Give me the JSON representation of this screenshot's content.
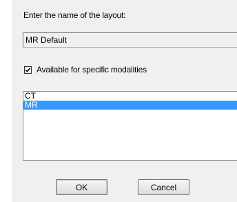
{
  "dialog": {
    "prompt": "Enter the name of the layout:",
    "name_value": "MR Default",
    "checkbox_label": "Available for specific modalities",
    "checkbox_checked": true,
    "modalities": [
      {
        "label": "CT",
        "selected": false
      },
      {
        "label": "MR",
        "selected": true
      }
    ],
    "ok_label": "OK",
    "cancel_label": "Cancel"
  },
  "colors": {
    "dialog_background": "#f0f0f0",
    "selection_background": "#3399ff",
    "selection_text": "#ffffff"
  }
}
